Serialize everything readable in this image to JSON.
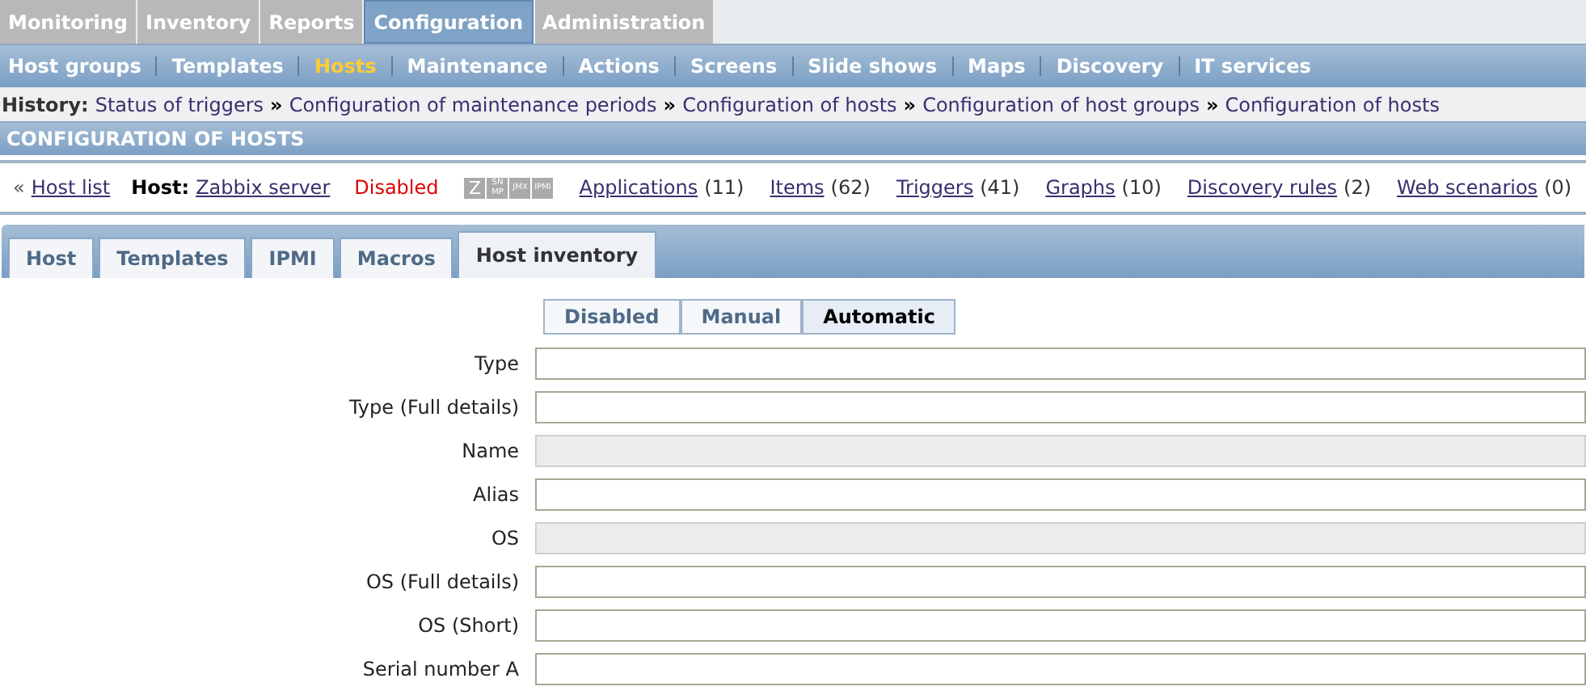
{
  "main_menu": [
    {
      "label": "Monitoring",
      "selected": false
    },
    {
      "label": "Inventory",
      "selected": false
    },
    {
      "label": "Reports",
      "selected": false
    },
    {
      "label": "Configuration",
      "selected": true
    },
    {
      "label": "Administration",
      "selected": false
    }
  ],
  "sub_menu": [
    {
      "label": "Host groups",
      "selected": false
    },
    {
      "label": "Templates",
      "selected": false
    },
    {
      "label": "Hosts",
      "selected": true
    },
    {
      "label": "Maintenance",
      "selected": false
    },
    {
      "label": "Actions",
      "selected": false
    },
    {
      "label": "Screens",
      "selected": false
    },
    {
      "label": "Slide shows",
      "selected": false
    },
    {
      "label": "Maps",
      "selected": false
    },
    {
      "label": "Discovery",
      "selected": false
    },
    {
      "label": "IT services",
      "selected": false
    }
  ],
  "history": {
    "label": "History:",
    "separator": "»",
    "items": [
      "Status of triggers",
      "Configuration of maintenance periods",
      "Configuration of hosts",
      "Configuration of host groups",
      "Configuration of hosts"
    ]
  },
  "page_title": "CONFIGURATION OF HOSTS",
  "host_bar": {
    "back_mark": "«",
    "host_list": "Host list",
    "host_label": "Host:",
    "host_name": "Zabbix server",
    "status": "Disabled",
    "availability": [
      {
        "lines": [
          "Z"
        ]
      },
      {
        "lines": [
          "SN",
          "MP"
        ]
      },
      {
        "lines": [
          "JMX"
        ]
      },
      {
        "lines": [
          "IPMI"
        ]
      }
    ],
    "links": [
      {
        "label": "Applications",
        "count": "(11)"
      },
      {
        "label": "Items",
        "count": "(62)"
      },
      {
        "label": "Triggers",
        "count": "(41)"
      },
      {
        "label": "Graphs",
        "count": "(10)"
      },
      {
        "label": "Discovery rules",
        "count": "(2)"
      },
      {
        "label": "Web scenarios",
        "count": "(0)"
      }
    ]
  },
  "tabs": [
    {
      "label": "Host",
      "selected": false
    },
    {
      "label": "Templates",
      "selected": false
    },
    {
      "label": "IPMI",
      "selected": false
    },
    {
      "label": "Macros",
      "selected": false
    },
    {
      "label": "Host inventory",
      "selected": true
    }
  ],
  "inventory_mode": [
    {
      "label": "Disabled",
      "selected": false
    },
    {
      "label": "Manual",
      "selected": false
    },
    {
      "label": "Automatic",
      "selected": true
    }
  ],
  "fields": [
    {
      "label": "Type",
      "disabled": false
    },
    {
      "label": "Type (Full details)",
      "disabled": false
    },
    {
      "label": "Name",
      "disabled": true
    },
    {
      "label": "Alias",
      "disabled": false
    },
    {
      "label": "OS",
      "disabled": true
    },
    {
      "label": "OS (Full details)",
      "disabled": false
    },
    {
      "label": "OS (Short)",
      "disabled": false
    },
    {
      "label": "Serial number A",
      "disabled": false
    }
  ]
}
